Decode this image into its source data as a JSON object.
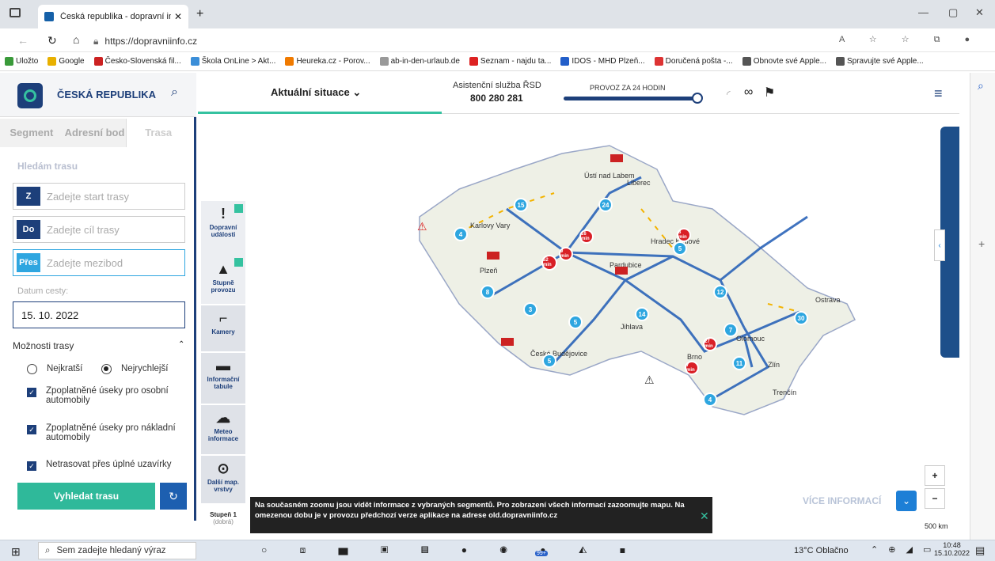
{
  "browser": {
    "tab_title": "Česká republika - dopravní infor",
    "url": "https://dopravniinfo.cz",
    "bookmarks": [
      "Uložto",
      "Google",
      "Česko-Slovenská fil...",
      "Škola OnLine > Akt...",
      "Heureka.cz - Porov...",
      "ab-in-den-urlaub.de",
      "Seznam - najdu ta...",
      "IDOS - MHD Plzeň...",
      "Doručená pošta -...",
      "Obnovte své Apple...",
      "Spravujte své Apple..."
    ]
  },
  "header": {
    "brand": "ČESKÁ REPUBLIKA",
    "situation": "Aktuální situace",
    "assist_label": "Asistenční služba ŘSD",
    "assist_phone": "800 280 281",
    "provoz": "PROVOZ ZA 24 HODIN"
  },
  "sidebar": {
    "tabs": [
      "Segment",
      "Adresní bod",
      "Trasa"
    ],
    "title": "Hledám trasu",
    "fields": [
      {
        "prefix": "Z",
        "placeholder": "Zadejte start trasy"
      },
      {
        "prefix": "Do",
        "placeholder": "Zadejte cíl trasy"
      },
      {
        "prefix": "Přes",
        "placeholder": "Zadejte mezibod"
      }
    ],
    "date_label": "Datum cesty:",
    "date_value": "15. 10. 2022",
    "options_label": "Možnosti trasy",
    "radio_short": "Nejkratší",
    "radio_fast": "Nejrychlejší",
    "check1": "Zpoplatněné úseky pro osobní automobily",
    "check2": "Zpoplatněné úseky pro nákladní automobily",
    "check3": "Netrasovat přes úplné uzavírky",
    "search_button": "Vyhledat trasu"
  },
  "layers": [
    {
      "icon": "!",
      "label": "Dopravní události"
    },
    {
      "icon": "▲",
      "label": "Stupně provozu"
    },
    {
      "icon": "⌐",
      "label": "Kamery"
    },
    {
      "icon": "▬",
      "label": "Informační tabule"
    },
    {
      "icon": "☁",
      "label": "Meteo informace"
    },
    {
      "icon": "⊙",
      "label": "Další map. vrstvy"
    }
  ],
  "map": {
    "cities": [
      "Ústí nad Labem",
      "Liberec",
      "Karlovy Vary",
      "Plzeň",
      "Hradec Králové",
      "Pardubice",
      "Jihlava",
      "České Budějovice",
      "Brno",
      "Olomouc",
      "Ostrava",
      "Zlín",
      "Trenčín"
    ],
    "blue_pins": [
      "15",
      "24",
      "4",
      "5",
      "8",
      "3",
      "5",
      "5",
      "14",
      "12",
      "7",
      "30",
      "11",
      "4"
    ],
    "red_pins": [
      "16 min",
      "8 min",
      "9 min",
      "52 min",
      "27 min",
      "7 min"
    ],
    "more_info": "VÍCE INFORMACÍ",
    "scale": "500 km",
    "zoom_in": "+",
    "zoom_out": "−",
    "notice": "Na současném zoomu jsou vidět informace z vybraných segmentů. Pro zobrazení všech informací zazoomujte mapu. Na omezenou dobu je v provozu předchozí verze aplikace na adrese old.dopravniinfo.cz",
    "legend_stage": "Stupeň 1",
    "legend_state": "(dobrá)"
  },
  "taskbar": {
    "search": "Sem zadejte hledaný výraz",
    "weather": "13°C Oblačno",
    "time": "10:48",
    "date": "15.10.2022",
    "badge": "99+"
  }
}
